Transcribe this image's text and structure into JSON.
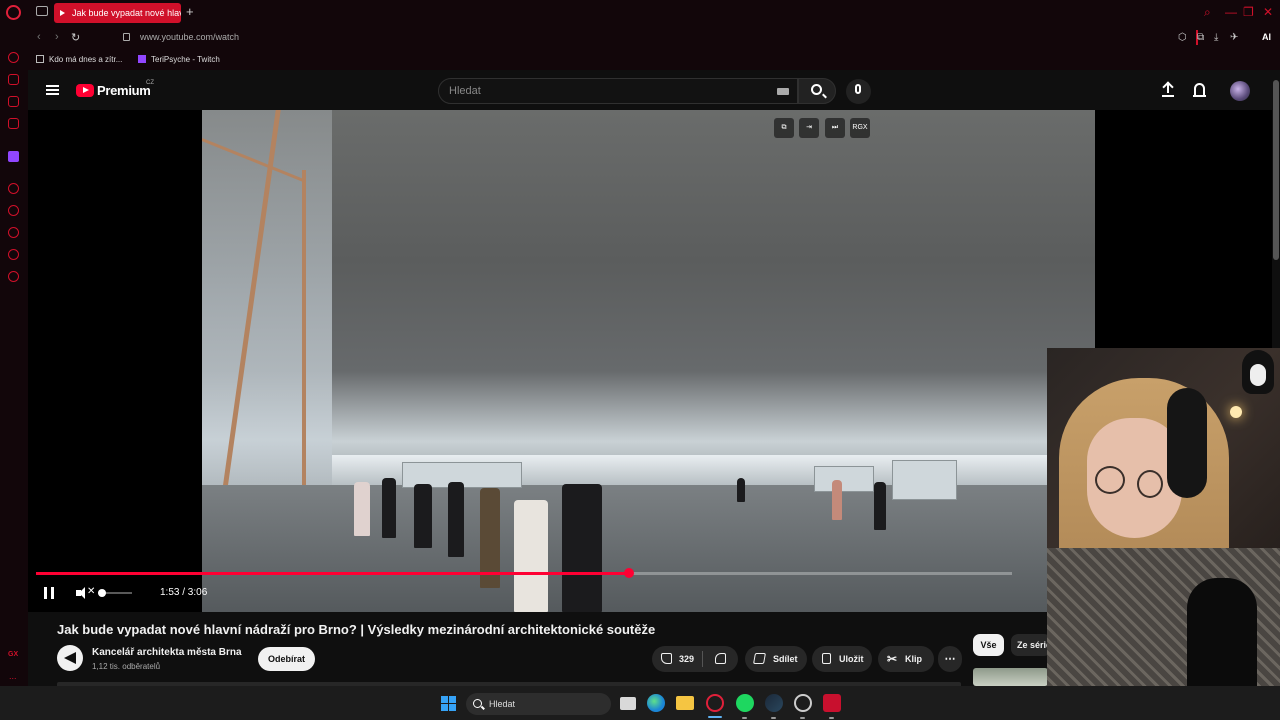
{
  "browser": {
    "tab_title": "Jak bude vypadat nové hlavní nádraží pro Brno?",
    "new_tab_label": "+",
    "url": "www.youtube.com/watch",
    "ai_label": "AI",
    "accent_color": "#d0102a"
  },
  "bookmarks": [
    {
      "label": "Kdo má dnes a zítr...",
      "icon": "page-icon"
    },
    {
      "label": "TeriPsyche - Twitch",
      "icon": "twitch-icon"
    }
  ],
  "sidebar": {
    "gx_label": "GX",
    "more_label": "..."
  },
  "youtube": {
    "brand": "Premium",
    "country": "CZ",
    "search_placeholder": "Hledat",
    "brand_color": "#ff0033"
  },
  "player": {
    "overlay_label": "RGX",
    "time_display": "1:53 / 3:06",
    "progress_fraction": 0.608,
    "volume_fraction": 0.0,
    "muted": true,
    "playing": true
  },
  "video": {
    "title": "Jak bude vypadat nové hlavní nádraží pro Brno? | Výsledky mezinárodní architektonické soutěže",
    "channel": "Kancelář architekta města Brna",
    "subscribers": "1,12 tis. odběratelů",
    "subscribe_label": "Odebírat",
    "like_count": "329",
    "share_label": "Sdílet",
    "save_label": "Uložit",
    "clip_label": "Klip",
    "more_label": "⋯"
  },
  "related": {
    "chip_all": "Vše",
    "chip_series": "Ze série"
  },
  "taskbar": {
    "search_label": "Hledat"
  }
}
